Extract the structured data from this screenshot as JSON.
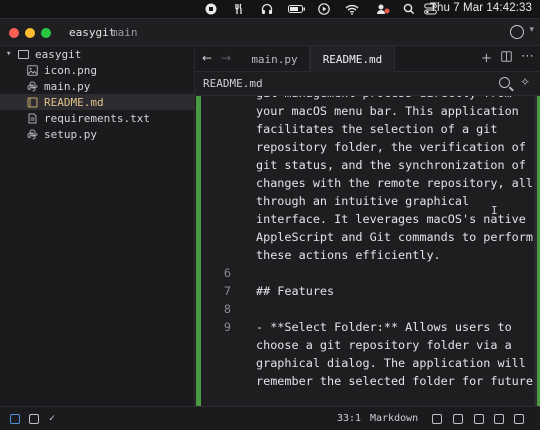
{
  "menubar": {
    "clock": "Thu 7 Mar  14:42:33",
    "icons": [
      "record-icon",
      "fork-knife-icon",
      "headphones-icon",
      "battery-icon",
      "play-circle-icon",
      "wifi-icon",
      "user-switch-icon",
      "search-icon",
      "control-center-icon"
    ]
  },
  "window": {
    "project_name": "easygit",
    "branch": "main"
  },
  "sidebar": {
    "root": "easygit",
    "files": [
      {
        "name": "icon.png",
        "icon": "image-icon"
      },
      {
        "name": "main.py",
        "icon": "python-icon"
      },
      {
        "name": "README.md",
        "icon": "book-icon"
      },
      {
        "name": "requirements.txt",
        "icon": "text-file-icon"
      },
      {
        "name": "setup.py",
        "icon": "python-icon"
      }
    ],
    "selected": "README.md"
  },
  "tabs": [
    {
      "label": "main.py",
      "active": false
    },
    {
      "label": "README.md",
      "active": true
    }
  ],
  "breadcrumb": "README.md",
  "editor": {
    "lines": [
      {
        "num": "",
        "text": "git management process directly from"
      },
      {
        "num": "",
        "text": "your macOS menu bar. This application"
      },
      {
        "num": "",
        "text": "facilitates the selection of a git"
      },
      {
        "num": "",
        "text": "repository folder, the verification of"
      },
      {
        "num": "",
        "text": "git status, and the synchronization of"
      },
      {
        "num": "",
        "text": "changes with the remote repository, all"
      },
      {
        "num": "",
        "text": "through an intuitive graphical"
      },
      {
        "num": "",
        "text": "interface. It leverages macOS's native"
      },
      {
        "num": "",
        "text": "AppleScript and Git commands to perform"
      },
      {
        "num": "",
        "text": "these actions efficiently."
      },
      {
        "num": "6",
        "text": ""
      },
      {
        "num": "7",
        "text": "## Features"
      },
      {
        "num": "8",
        "text": ""
      },
      {
        "num": "9",
        "text": "- **Select Folder:** Allows users to"
      },
      {
        "num": "",
        "text": "choose a git repository folder via a"
      },
      {
        "num": "",
        "text": "graphical dialog. The application will"
      },
      {
        "num": "",
        "text": "remember the selected folder for future"
      }
    ]
  },
  "statusbar": {
    "cursor_position": "33:1",
    "language": "Markdown",
    "check": "✓"
  },
  "colors": {
    "git_added": "#4a9a44",
    "background": "#1e1e21"
  }
}
